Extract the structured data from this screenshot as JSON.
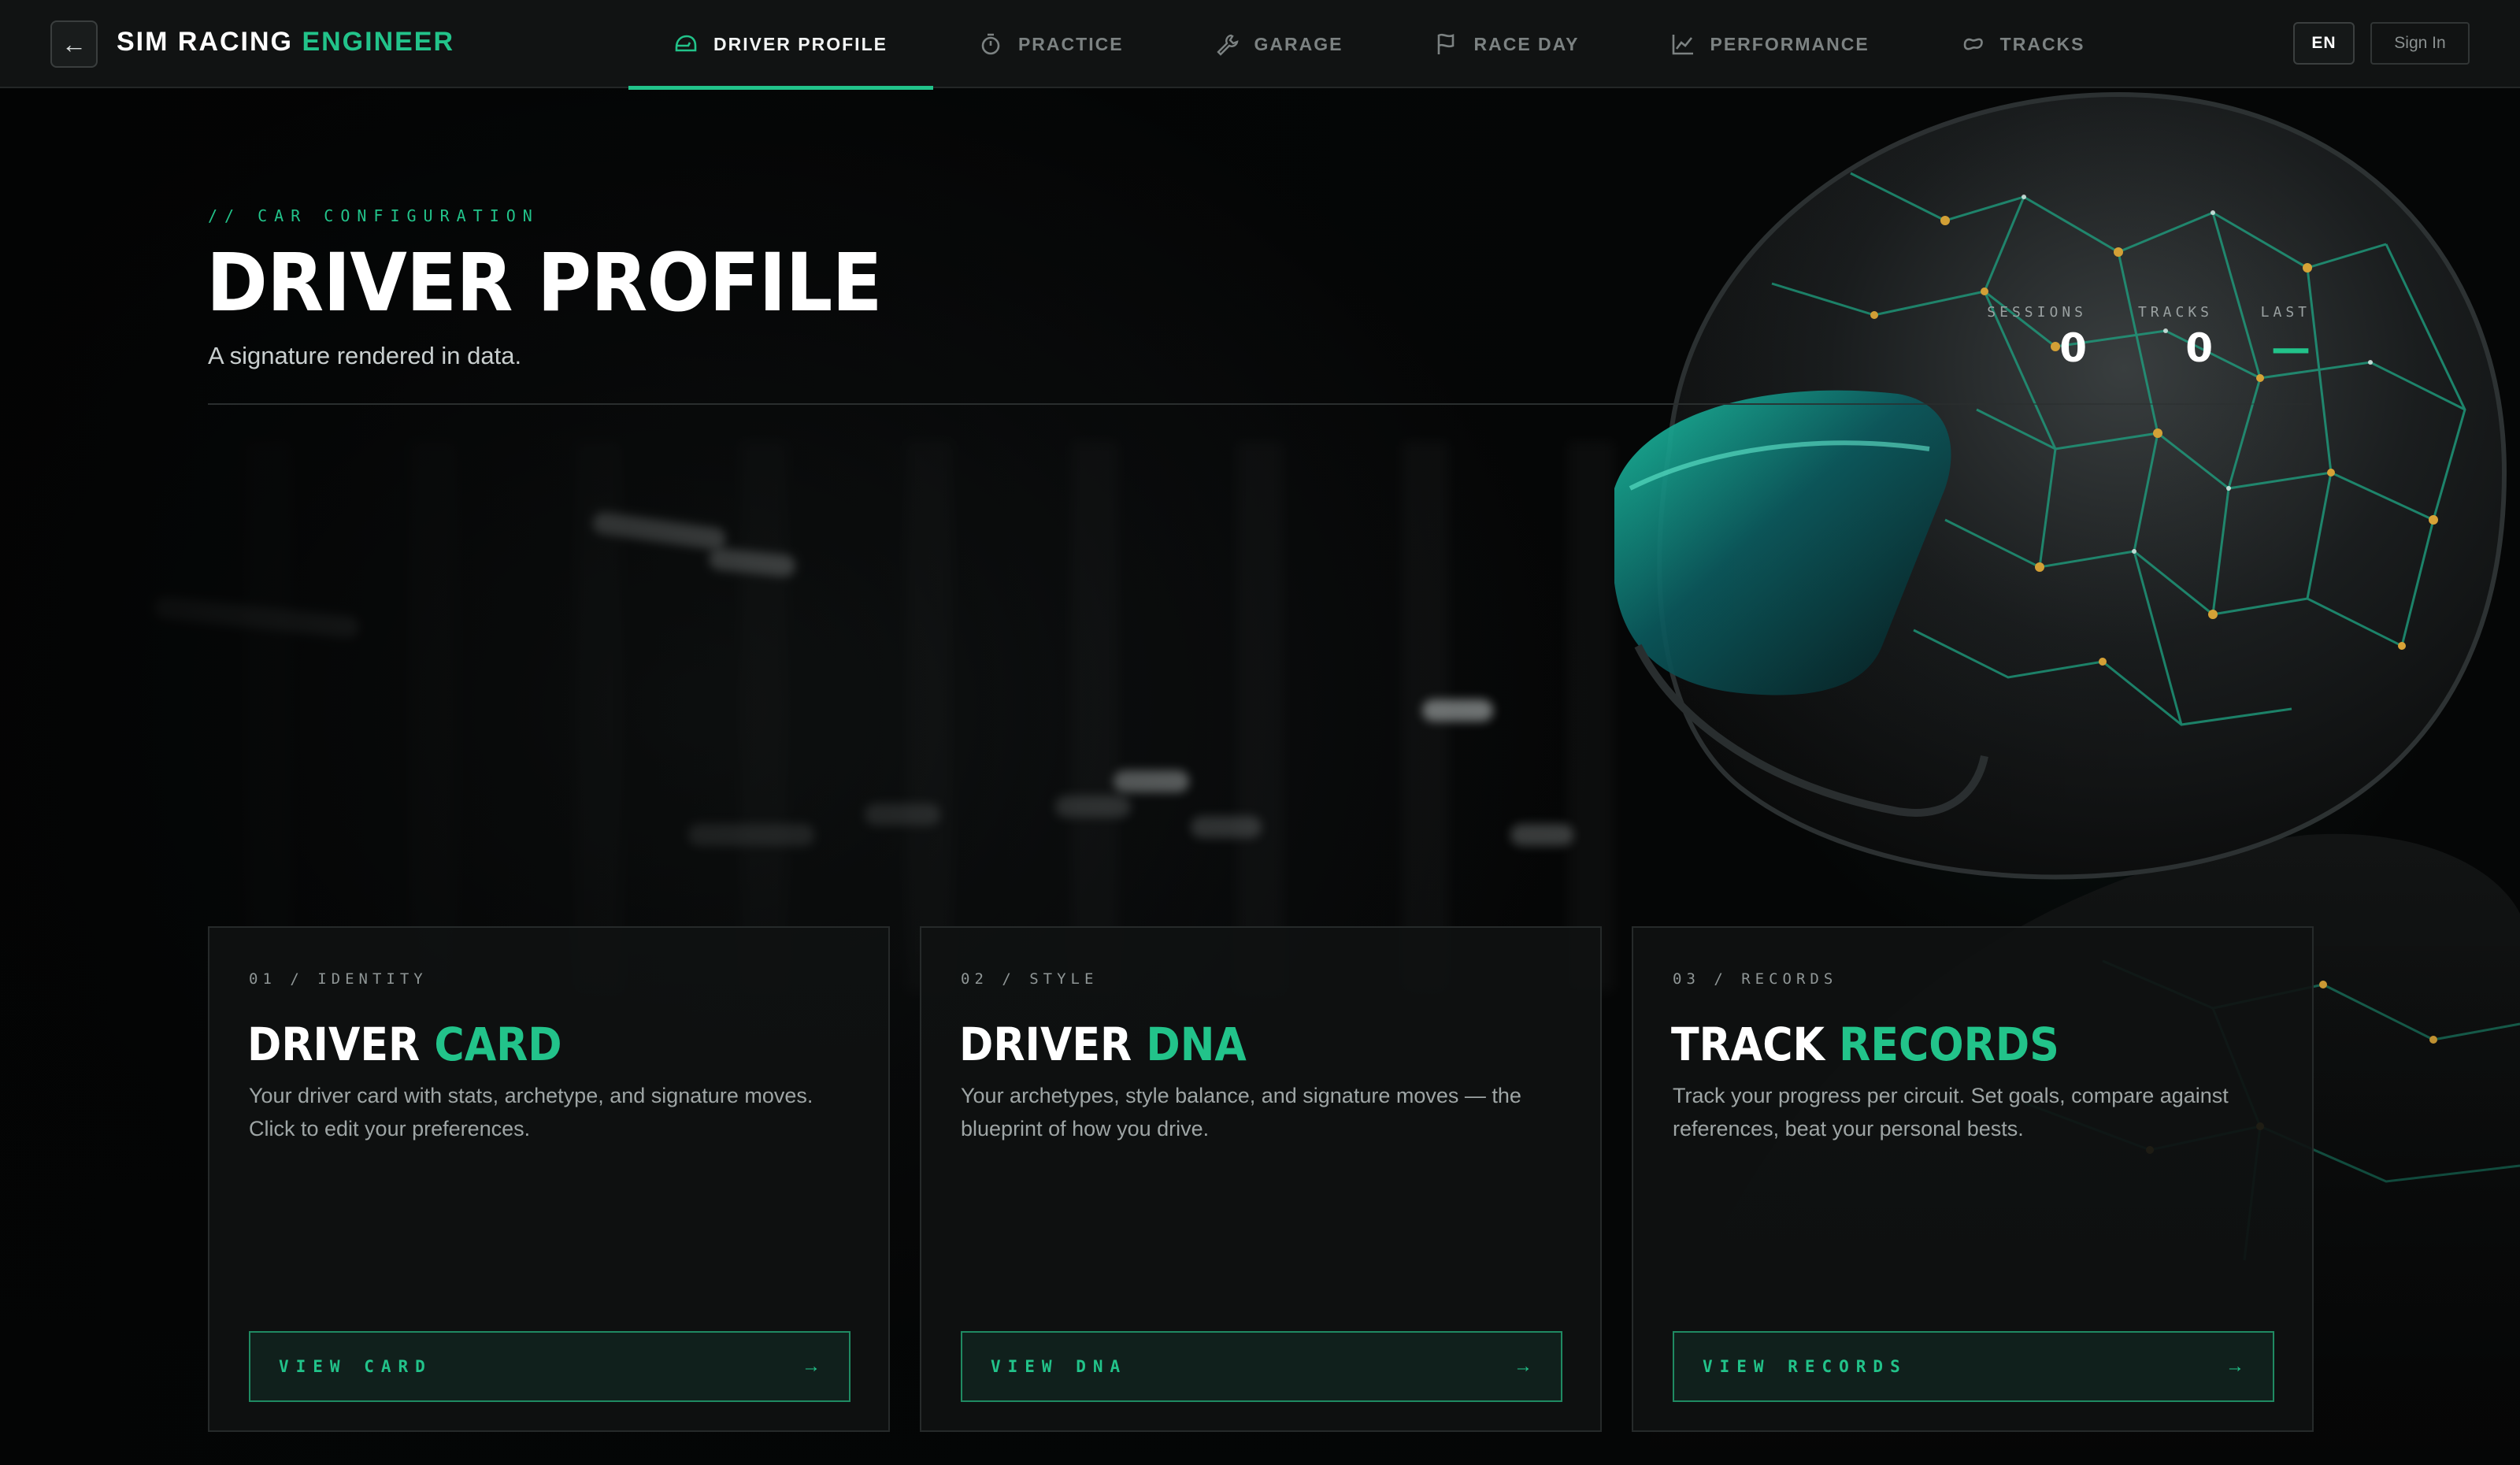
{
  "app": {
    "brand_main": "SIM RACING",
    "brand_accent": "ENGINEER",
    "back_symbol": "←"
  },
  "nav": {
    "items": [
      {
        "label": "DRIVER PROFILE",
        "icon": "helmet-icon",
        "active": true
      },
      {
        "label": "PRACTICE",
        "icon": "stopwatch-icon",
        "active": false
      },
      {
        "label": "GARAGE",
        "icon": "wrench-icon",
        "active": false
      },
      {
        "label": "RACE DAY",
        "icon": "flag-icon",
        "active": false
      },
      {
        "label": "PERFORMANCE",
        "icon": "chart-line-icon",
        "active": false
      },
      {
        "label": "TRACKS",
        "icon": "circuit-icon",
        "active": false
      }
    ],
    "lang": "EN",
    "signin": "Sign In"
  },
  "hero": {
    "eyebrow": "// CAR CONFIGURATION",
    "title": "DRIVER PROFILE",
    "subtitle": "A signature rendered in data."
  },
  "stats": [
    {
      "label": "SESSIONS",
      "value": "0"
    },
    {
      "label": "TRACKS",
      "value": "0"
    },
    {
      "label": "LAST",
      "value": "—"
    }
  ],
  "cards": [
    {
      "kicker": "01 / IDENTITY",
      "title_main": "DRIVER",
      "title_accent": "CARD",
      "desc": "Your driver card with stats, archetype, and signature moves. Click to edit your preferences.",
      "cta": "VIEW CARD",
      "arrow": "→"
    },
    {
      "kicker": "02 / STYLE",
      "title_main": "DRIVER",
      "title_accent": "DNA",
      "desc": "Your archetypes, style balance, and signature moves — the blueprint of how you drive.",
      "cta": "VIEW DNA",
      "arrow": "→"
    },
    {
      "kicker": "03 / RECORDS",
      "title_main": "TRACK",
      "title_accent": "RECORDS",
      "desc": "Track your progress per circuit. Set goals, compare against references, beat your personal bests.",
      "cta": "VIEW RECORDS",
      "arrow": "→"
    }
  ],
  "theme": {
    "accent": "#22c38a",
    "background": "#050606",
    "topbar": "#111313"
  }
}
